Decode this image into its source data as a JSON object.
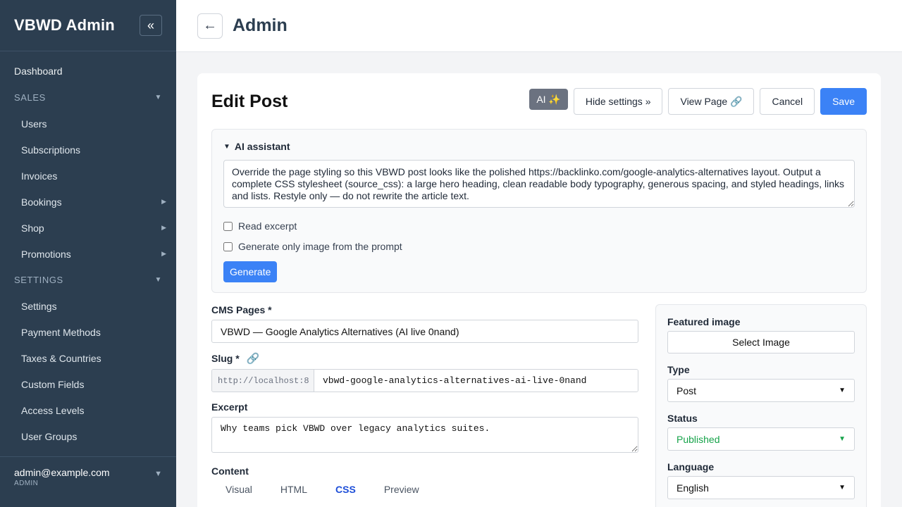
{
  "sidebar": {
    "brand": "VBWD Admin",
    "collapse_icon": "«",
    "dashboard": "Dashboard",
    "sales_section": "SALES",
    "sales_items": [
      "Users",
      "Subscriptions",
      "Invoices",
      "Bookings",
      "Shop",
      "Promotions"
    ],
    "settings_section": "SETTINGS",
    "settings_items": [
      "Settings",
      "Payment Methods",
      "Taxes & Countries",
      "Custom Fields",
      "Access Levels",
      "User Groups"
    ],
    "user_email": "admin@example.com",
    "user_role": "ADMIN"
  },
  "topbar": {
    "back_icon": "←",
    "title": "Admin"
  },
  "editor": {
    "title": "Edit Post",
    "ai_button": "AI ✨",
    "hide_settings": "Hide settings »",
    "view_page": "View Page 🔗",
    "cancel": "Cancel",
    "save": "Save"
  },
  "ai_assistant": {
    "title": "AI assistant",
    "prompt": "Override the page styling so this VBWD post looks like the polished https://backlinko.com/google-analytics-alternatives layout. Output a complete CSS stylesheet (source_css): a large hero heading, clean readable body typography, generous spacing, and styled headings, links and lists. Restyle only — do not rewrite the article text.",
    "read_excerpt": "Read excerpt",
    "image_only": "Generate only image from the prompt",
    "generate": "Generate"
  },
  "form": {
    "cms_pages_label": "CMS Pages *",
    "cms_pages_value": "VBWD — Google Analytics Alternatives (AI live 0nand)",
    "slug_label": "Slug *",
    "slug_prefix": "http://localhost:8",
    "slug_value": "vbwd-google-analytics-alternatives-ai-live-0nand",
    "excerpt_label": "Excerpt",
    "excerpt_value": "Why teams pick VBWD over legacy analytics suites.",
    "content_label": "Content",
    "content_tabs": [
      "Visual",
      "HTML",
      "CSS",
      "Preview"
    ],
    "active_tab": "CSS"
  },
  "settings_panel": {
    "featured_image_label": "Featured image",
    "select_image": "Select Image",
    "type_label": "Type",
    "type_value": "Post",
    "status_label": "Status",
    "status_value": "Published",
    "language_label": "Language",
    "language_value": "English"
  },
  "colors": {
    "sidebar_bg": "#2c3e50",
    "primary": "#3b82f6",
    "published": "#16a34a"
  }
}
